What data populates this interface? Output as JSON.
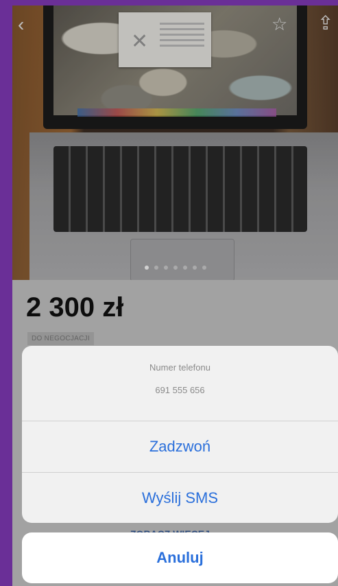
{
  "listing": {
    "price": "2 300 zł",
    "negotiable_badge": "DO NEGOCJACJI",
    "see_more": "ZOBACZ WIĘCEJ"
  },
  "photo": {
    "pager_count": 7,
    "pager_active": 0
  },
  "action_sheet": {
    "title": "Numer telefonu",
    "phone": "691 555 656",
    "call_label": "Zadzwoń",
    "sms_label": "Wyślij SMS",
    "cancel_label": "Anuluj"
  },
  "colors": {
    "accent": "#2a6fdb",
    "frame": "#6a2f97"
  },
  "icons": {
    "back": "back-arrow-icon",
    "favorite": "star-icon",
    "share": "share-icon"
  }
}
